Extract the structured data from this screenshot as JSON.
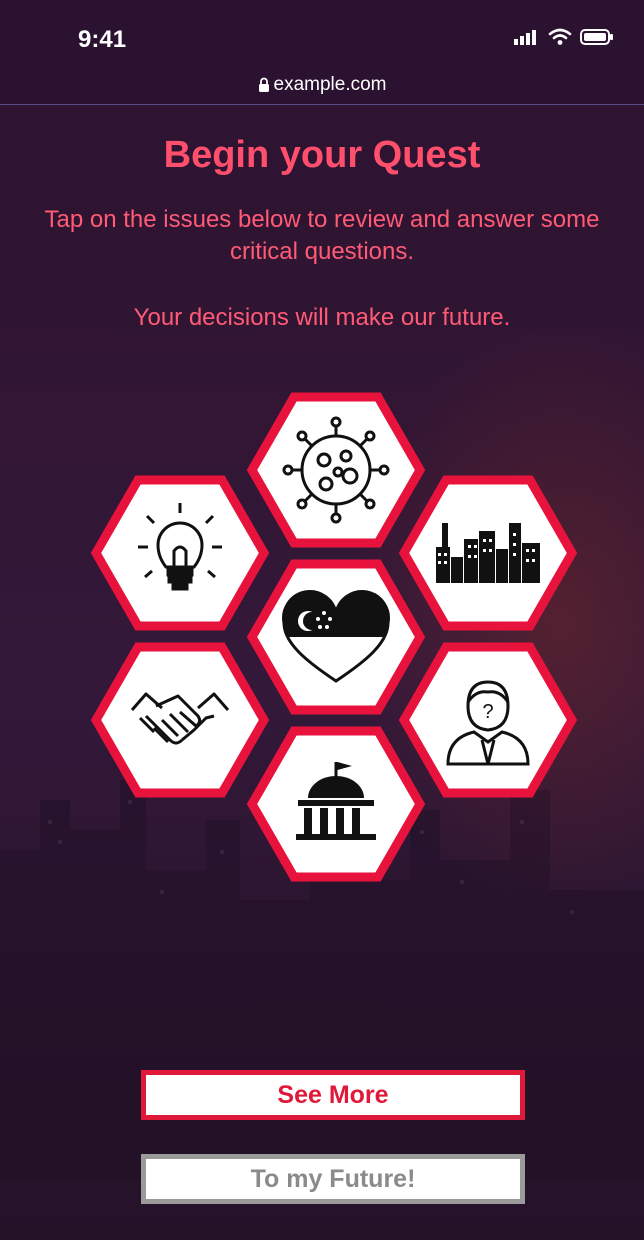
{
  "status_bar": {
    "time": "9:41",
    "signal_icon": "cellular-signal-icon",
    "wifi_icon": "wifi-icon",
    "battery_icon": "battery-icon"
  },
  "browser": {
    "url": "example.com",
    "lock_icon": "lock-icon"
  },
  "intro": {
    "title": "Begin your Quest",
    "subtitle": "Tap on the issues below to review and answer some critical questions.",
    "tagline": "Your decisions will make our future."
  },
  "issues": [
    {
      "id": "virus",
      "icon": "virus-icon"
    },
    {
      "id": "idea",
      "icon": "lightbulb-icon"
    },
    {
      "id": "city",
      "icon": "city-skyline-icon"
    },
    {
      "id": "singapore",
      "icon": "singapore-heart-icon"
    },
    {
      "id": "partnership",
      "icon": "handshake-icon"
    },
    {
      "id": "person",
      "icon": "person-question-icon"
    },
    {
      "id": "government",
      "icon": "government-building-icon"
    }
  ],
  "actions": {
    "see_more": "See More",
    "to_future": "To my Future!"
  },
  "colors": {
    "accent": "#e0183a",
    "title": "#ff4f6d",
    "background": "#2c1330",
    "disabled": "#9a9a9a"
  }
}
